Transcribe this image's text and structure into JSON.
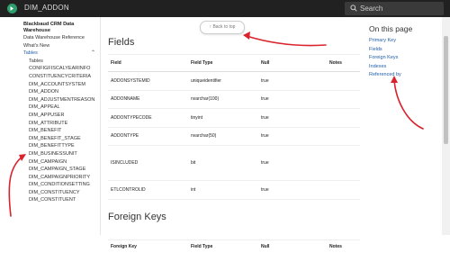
{
  "header": {
    "title": "DIM_ADDON",
    "search_placeholder": "Search"
  },
  "nav": {
    "header": "Blackbaud CRM Data Warehouse",
    "items": [
      "Data Warehouse Reference",
      "What's New"
    ],
    "tables_label": "Tables",
    "tables_children": [
      "Tables",
      "CONFIGFISCALYEARINFO",
      "CONSTITUENCYCRITERIA",
      "DIM_ACCOUNTSYSTEM",
      "DIM_ADDON",
      "DIM_ADJUSTMENTREASON",
      "DIM_APPEAL",
      "DIM_APPUSER",
      "DIM_ATTRIBUTE",
      "DIM_BENEFIT",
      "DIM_BENEFIT_STAGE",
      "DIM_BENEFITTYPE",
      "DIM_BUSINESSUNIT",
      "DIM_CAMPAIGN",
      "DIM_CAMPAIGN_STAGE",
      "DIM_CAMPAIGNPRIORITY",
      "DIM_CONDITIONSETTING",
      "DIM_CONSTITUENCY",
      "DIM_CONSTITUENT"
    ]
  },
  "back_to_top": "Back to top",
  "fields": {
    "heading": "Fields",
    "columns": [
      "Field",
      "Field Type",
      "Null",
      "Notes"
    ],
    "rows": [
      [
        "ADDONSYSTEMID",
        "uniqueidentifier",
        "true",
        ""
      ],
      [
        "ADDONNAME",
        "nvarchar(100)",
        "true",
        ""
      ],
      [
        "ADDONTYPECODE",
        "tinyint",
        "true",
        ""
      ],
      [
        "ADDONTYPE",
        "nvarchar(50)",
        "true",
        ""
      ],
      [
        "ISINCLUDED",
        "bit",
        "true",
        ""
      ],
      [
        "ETLCONTROLID",
        "int",
        "true",
        ""
      ]
    ]
  },
  "foreign_keys": {
    "heading": "Foreign Keys",
    "columns": [
      "Foreign Key",
      "Field Type",
      "Null",
      "Notes"
    ]
  },
  "on_this_page": {
    "title": "On this page",
    "links": [
      "Primary Key",
      "Fields",
      "Foreign Keys",
      "Indexes",
      "Referenced by"
    ]
  },
  "colors": {
    "header_bg": "#212121",
    "link": "#1f5fa8",
    "logo": "#2e9e6e",
    "annotation": "#d9232d"
  },
  "icons": {
    "logo": "logo-icon",
    "search": "search-icon",
    "caret": "caret-up-icon",
    "back_to_top": "arrow-up-icon"
  }
}
